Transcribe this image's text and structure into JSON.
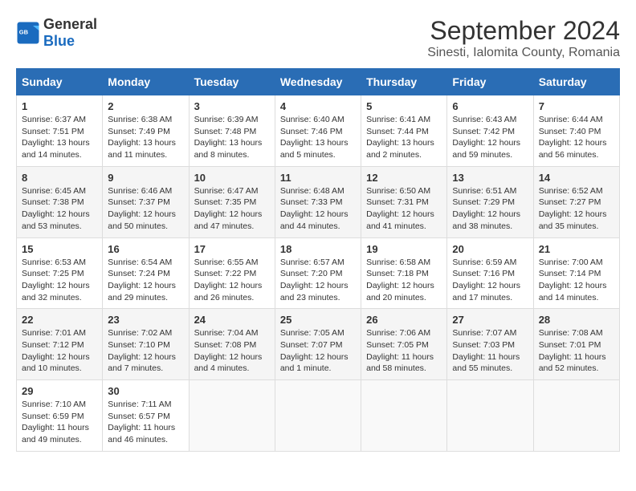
{
  "header": {
    "logo_general": "General",
    "logo_blue": "Blue",
    "title": "September 2024",
    "subtitle": "Sinesti, Ialomita County, Romania"
  },
  "weekdays": [
    "Sunday",
    "Monday",
    "Tuesday",
    "Wednesday",
    "Thursday",
    "Friday",
    "Saturday"
  ],
  "weeks": [
    [
      {
        "day": "1",
        "sunrise": "6:37 AM",
        "sunset": "7:51 PM",
        "daylight": "13 hours and 14 minutes."
      },
      {
        "day": "2",
        "sunrise": "6:38 AM",
        "sunset": "7:49 PM",
        "daylight": "13 hours and 11 minutes."
      },
      {
        "day": "3",
        "sunrise": "6:39 AM",
        "sunset": "7:48 PM",
        "daylight": "13 hours and 8 minutes."
      },
      {
        "day": "4",
        "sunrise": "6:40 AM",
        "sunset": "7:46 PM",
        "daylight": "13 hours and 5 minutes."
      },
      {
        "day": "5",
        "sunrise": "6:41 AM",
        "sunset": "7:44 PM",
        "daylight": "13 hours and 2 minutes."
      },
      {
        "day": "6",
        "sunrise": "6:43 AM",
        "sunset": "7:42 PM",
        "daylight": "12 hours and 59 minutes."
      },
      {
        "day": "7",
        "sunrise": "6:44 AM",
        "sunset": "7:40 PM",
        "daylight": "12 hours and 56 minutes."
      }
    ],
    [
      {
        "day": "8",
        "sunrise": "6:45 AM",
        "sunset": "7:38 PM",
        "daylight": "12 hours and 53 minutes."
      },
      {
        "day": "9",
        "sunrise": "6:46 AM",
        "sunset": "7:37 PM",
        "daylight": "12 hours and 50 minutes."
      },
      {
        "day": "10",
        "sunrise": "6:47 AM",
        "sunset": "7:35 PM",
        "daylight": "12 hours and 47 minutes."
      },
      {
        "day": "11",
        "sunrise": "6:48 AM",
        "sunset": "7:33 PM",
        "daylight": "12 hours and 44 minutes."
      },
      {
        "day": "12",
        "sunrise": "6:50 AM",
        "sunset": "7:31 PM",
        "daylight": "12 hours and 41 minutes."
      },
      {
        "day": "13",
        "sunrise": "6:51 AM",
        "sunset": "7:29 PM",
        "daylight": "12 hours and 38 minutes."
      },
      {
        "day": "14",
        "sunrise": "6:52 AM",
        "sunset": "7:27 PM",
        "daylight": "12 hours and 35 minutes."
      }
    ],
    [
      {
        "day": "15",
        "sunrise": "6:53 AM",
        "sunset": "7:25 PM",
        "daylight": "12 hours and 32 minutes."
      },
      {
        "day": "16",
        "sunrise": "6:54 AM",
        "sunset": "7:24 PM",
        "daylight": "12 hours and 29 minutes."
      },
      {
        "day": "17",
        "sunrise": "6:55 AM",
        "sunset": "7:22 PM",
        "daylight": "12 hours and 26 minutes."
      },
      {
        "day": "18",
        "sunrise": "6:57 AM",
        "sunset": "7:20 PM",
        "daylight": "12 hours and 23 minutes."
      },
      {
        "day": "19",
        "sunrise": "6:58 AM",
        "sunset": "7:18 PM",
        "daylight": "12 hours and 20 minutes."
      },
      {
        "day": "20",
        "sunrise": "6:59 AM",
        "sunset": "7:16 PM",
        "daylight": "12 hours and 17 minutes."
      },
      {
        "day": "21",
        "sunrise": "7:00 AM",
        "sunset": "7:14 PM",
        "daylight": "12 hours and 14 minutes."
      }
    ],
    [
      {
        "day": "22",
        "sunrise": "7:01 AM",
        "sunset": "7:12 PM",
        "daylight": "12 hours and 10 minutes."
      },
      {
        "day": "23",
        "sunrise": "7:02 AM",
        "sunset": "7:10 PM",
        "daylight": "12 hours and 7 minutes."
      },
      {
        "day": "24",
        "sunrise": "7:04 AM",
        "sunset": "7:08 PM",
        "daylight": "12 hours and 4 minutes."
      },
      {
        "day": "25",
        "sunrise": "7:05 AM",
        "sunset": "7:07 PM",
        "daylight": "12 hours and 1 minute."
      },
      {
        "day": "26",
        "sunrise": "7:06 AM",
        "sunset": "7:05 PM",
        "daylight": "11 hours and 58 minutes."
      },
      {
        "day": "27",
        "sunrise": "7:07 AM",
        "sunset": "7:03 PM",
        "daylight": "11 hours and 55 minutes."
      },
      {
        "day": "28",
        "sunrise": "7:08 AM",
        "sunset": "7:01 PM",
        "daylight": "11 hours and 52 minutes."
      }
    ],
    [
      {
        "day": "29",
        "sunrise": "7:10 AM",
        "sunset": "6:59 PM",
        "daylight": "11 hours and 49 minutes."
      },
      {
        "day": "30",
        "sunrise": "7:11 AM",
        "sunset": "6:57 PM",
        "daylight": "11 hours and 46 minutes."
      },
      null,
      null,
      null,
      null,
      null
    ]
  ]
}
